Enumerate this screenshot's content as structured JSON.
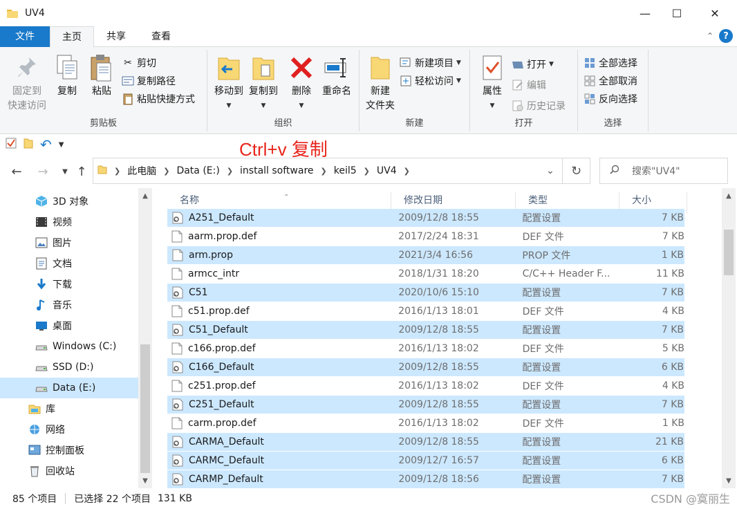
{
  "window": {
    "title": "UV4"
  },
  "ribbon_tabs": {
    "file": "文件",
    "home": "主页",
    "share": "共享",
    "view": "查看"
  },
  "ribbon": {
    "clipboard": {
      "label": "剪贴板",
      "pin": "固定到\n快速访问",
      "pin_line1": "固定到",
      "pin_line2": "快速访问",
      "copy": "复制",
      "paste": "粘贴",
      "cut": "剪切",
      "copy_path": "复制路径",
      "paste_shortcut": "粘贴快捷方式"
    },
    "organize": {
      "label": "组织",
      "move_to": "移动到",
      "copy_to": "复制到",
      "delete": "删除",
      "rename": "重命名"
    },
    "new": {
      "label": "新建",
      "new_folder_line1": "新建",
      "new_folder_line2": "文件夹",
      "new_item": "新建项目",
      "easy_access": "轻松访问"
    },
    "open": {
      "label": "打开",
      "properties": "属性",
      "open": "打开",
      "edit": "编辑",
      "history": "历史记录"
    },
    "select": {
      "label": "选择",
      "select_all": "全部选择",
      "select_none": "全部取消",
      "invert": "反向选择"
    }
  },
  "annotation": "Ctrl+v 复制",
  "address": {
    "crumbs": [
      "此电脑",
      "Data (E:)",
      "install software",
      "keil5",
      "UV4"
    ],
    "search_placeholder": "搜索\"UV4\""
  },
  "nav_items": [
    {
      "label": "3D 对象",
      "icon": "3d-objects-icon"
    },
    {
      "label": "视频",
      "icon": "video-icon"
    },
    {
      "label": "图片",
      "icon": "pictures-icon"
    },
    {
      "label": "文档",
      "icon": "documents-icon"
    },
    {
      "label": "下载",
      "icon": "download-icon"
    },
    {
      "label": "音乐",
      "icon": "music-icon"
    },
    {
      "label": "桌面",
      "icon": "desktop-icon"
    },
    {
      "label": "Windows (C:)",
      "icon": "drive-icon"
    },
    {
      "label": "SSD (D:)",
      "icon": "drive-icon"
    },
    {
      "label": "Data (E:)",
      "icon": "drive-icon"
    },
    {
      "label": "库",
      "icon": "library-icon"
    },
    {
      "label": "网络",
      "icon": "network-icon"
    },
    {
      "label": "控制面板",
      "icon": "control-panel-icon"
    },
    {
      "label": "回收站",
      "icon": "recycle-bin-icon"
    }
  ],
  "columns": {
    "name": "名称",
    "date": "修改日期",
    "type": "类型",
    "size": "大小"
  },
  "files": [
    {
      "name": "A251_Default",
      "date": "2009/12/8 18:55",
      "type": "配置设置",
      "size": "7 KB",
      "selected": true,
      "kind": "ini"
    },
    {
      "name": "aarm.prop.def",
      "date": "2017/2/24 18:31",
      "type": "DEF 文件",
      "size": "7 KB",
      "selected": false,
      "kind": "doc"
    },
    {
      "name": "arm.prop",
      "date": "2021/3/4 16:56",
      "type": "PROP 文件",
      "size": "1 KB",
      "selected": true,
      "kind": "doc"
    },
    {
      "name": "armcc_intr",
      "date": "2018/1/31 18:20",
      "type": "C/C++ Header F...",
      "size": "11 KB",
      "selected": false,
      "kind": "doc"
    },
    {
      "name": "C51",
      "date": "2020/10/6 15:10",
      "type": "配置设置",
      "size": "7 KB",
      "selected": true,
      "kind": "ini"
    },
    {
      "name": "c51.prop.def",
      "date": "2016/1/13 18:01",
      "type": "DEF 文件",
      "size": "4 KB",
      "selected": false,
      "kind": "doc"
    },
    {
      "name": "C51_Default",
      "date": "2009/12/8 18:55",
      "type": "配置设置",
      "size": "7 KB",
      "selected": true,
      "kind": "ini"
    },
    {
      "name": "c166.prop.def",
      "date": "2016/1/13 18:02",
      "type": "DEF 文件",
      "size": "5 KB",
      "selected": false,
      "kind": "doc"
    },
    {
      "name": "C166_Default",
      "date": "2009/12/8 18:55",
      "type": "配置设置",
      "size": "6 KB",
      "selected": true,
      "kind": "ini"
    },
    {
      "name": "c251.prop.def",
      "date": "2016/1/13 18:02",
      "type": "DEF 文件",
      "size": "4 KB",
      "selected": false,
      "kind": "doc"
    },
    {
      "name": "C251_Default",
      "date": "2009/12/8 18:55",
      "type": "配置设置",
      "size": "7 KB",
      "selected": true,
      "kind": "ini"
    },
    {
      "name": "carm.prop.def",
      "date": "2016/1/13 18:02",
      "type": "DEF 文件",
      "size": "1 KB",
      "selected": false,
      "kind": "doc"
    },
    {
      "name": "CARMA_Default",
      "date": "2009/12/8 18:55",
      "type": "配置设置",
      "size": "21 KB",
      "selected": true,
      "kind": "ini"
    },
    {
      "name": "CARMC_Default",
      "date": "2009/12/7 16:57",
      "type": "配置设置",
      "size": "6 KB",
      "selected": true,
      "kind": "ini"
    },
    {
      "name": "CARMP_Default",
      "date": "2009/12/8 18:56",
      "type": "配置设置",
      "size": "7 KB",
      "selected": true,
      "kind": "ini"
    }
  ],
  "status": {
    "count": "85 个项目",
    "selected": "已选择 22 个项目",
    "size": "131 KB"
  },
  "watermark": "CSDN @寞丽生",
  "colors": {
    "accent": "#1979ca",
    "selection": "#cce8ff",
    "annotation": "#e8251c"
  }
}
